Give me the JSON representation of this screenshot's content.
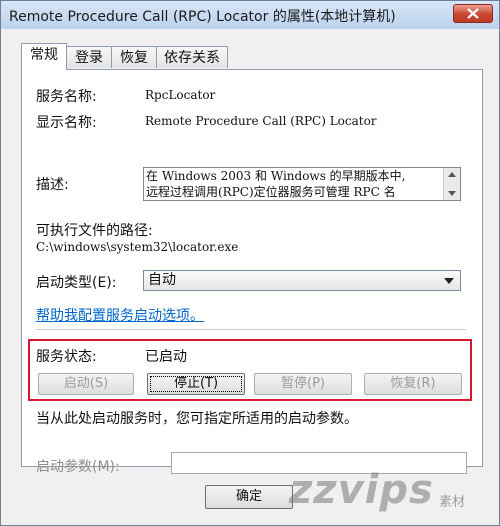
{
  "window": {
    "title": "Remote Procedure Call (RPC) Locator 的属性(本地计算机)"
  },
  "tabs": [
    {
      "label": "常规",
      "active": true
    },
    {
      "label": "登录",
      "active": false
    },
    {
      "label": "恢复",
      "active": false
    },
    {
      "label": "依存关系",
      "active": false
    }
  ],
  "general": {
    "service_name_label": "服务名称:",
    "service_name_value": "RpcLocator",
    "display_name_label": "显示名称:",
    "display_name_value": "Remote Procedure Call (RPC) Locator",
    "description_label": "描述:",
    "description_lines": [
      "在 Windows 2003 和 Windows 的早期版本中,",
      "远程过程调用(RPC)定位器服务可管理 RPC 名"
    ],
    "exe_path_label": "可执行文件的路径:",
    "exe_path_value": "C:\\windows\\system32\\locator.exe",
    "startup_type_label": "启动类型(E):",
    "startup_type_value": "自动",
    "help_link": "帮助我配置服务启动选项。",
    "service_status_label": "服务状态:",
    "service_status_value": "已启动",
    "start_button": "启动(S)",
    "stop_button": "停止(T)",
    "pause_button": "暂停(P)",
    "resume_button": "恢复(R)",
    "params_hint": "当从此处启动服务时，您可指定所适用的启动参数。",
    "start_params_label": "启动参数(M):",
    "start_params_value": ""
  },
  "footer": {
    "ok_button": "确定"
  },
  "watermark": {
    "text": "zzvips",
    "suffix": "素材"
  }
}
